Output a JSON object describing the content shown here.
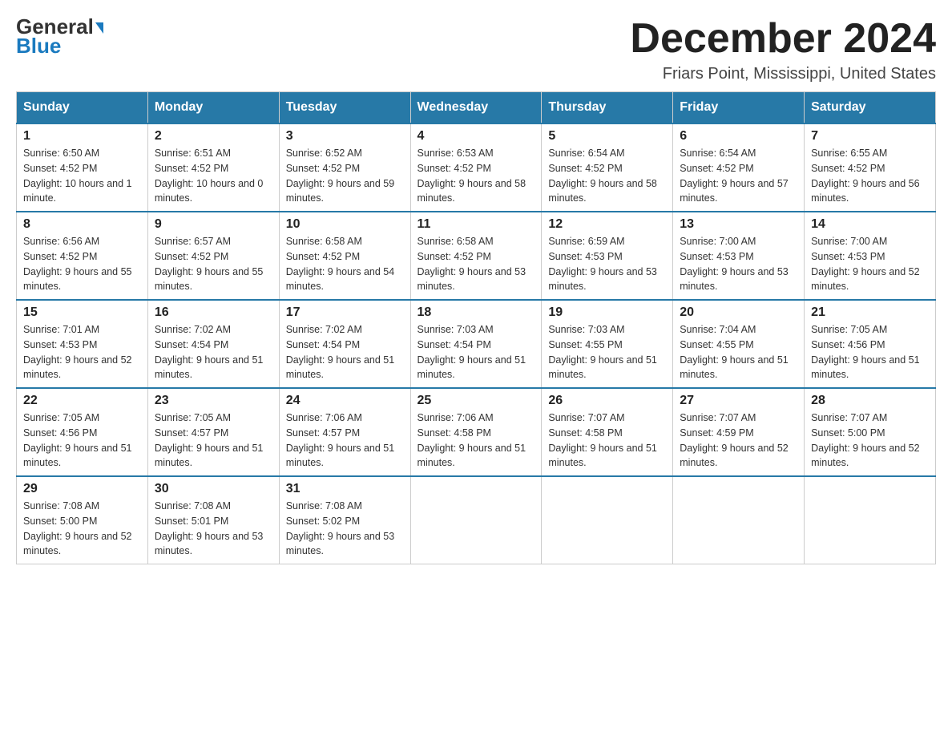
{
  "header": {
    "logo_line1": "General",
    "logo_line2": "Blue",
    "month_title": "December 2024",
    "location": "Friars Point, Mississippi, United States"
  },
  "days_of_week": [
    "Sunday",
    "Monday",
    "Tuesday",
    "Wednesday",
    "Thursday",
    "Friday",
    "Saturday"
  ],
  "weeks": [
    [
      {
        "day": "1",
        "sunrise": "6:50 AM",
        "sunset": "4:52 PM",
        "daylight": "10 hours and 1 minute."
      },
      {
        "day": "2",
        "sunrise": "6:51 AM",
        "sunset": "4:52 PM",
        "daylight": "10 hours and 0 minutes."
      },
      {
        "day": "3",
        "sunrise": "6:52 AM",
        "sunset": "4:52 PM",
        "daylight": "9 hours and 59 minutes."
      },
      {
        "day": "4",
        "sunrise": "6:53 AM",
        "sunset": "4:52 PM",
        "daylight": "9 hours and 58 minutes."
      },
      {
        "day": "5",
        "sunrise": "6:54 AM",
        "sunset": "4:52 PM",
        "daylight": "9 hours and 58 minutes."
      },
      {
        "day": "6",
        "sunrise": "6:54 AM",
        "sunset": "4:52 PM",
        "daylight": "9 hours and 57 minutes."
      },
      {
        "day": "7",
        "sunrise": "6:55 AM",
        "sunset": "4:52 PM",
        "daylight": "9 hours and 56 minutes."
      }
    ],
    [
      {
        "day": "8",
        "sunrise": "6:56 AM",
        "sunset": "4:52 PM",
        "daylight": "9 hours and 55 minutes."
      },
      {
        "day": "9",
        "sunrise": "6:57 AM",
        "sunset": "4:52 PM",
        "daylight": "9 hours and 55 minutes."
      },
      {
        "day": "10",
        "sunrise": "6:58 AM",
        "sunset": "4:52 PM",
        "daylight": "9 hours and 54 minutes."
      },
      {
        "day": "11",
        "sunrise": "6:58 AM",
        "sunset": "4:52 PM",
        "daylight": "9 hours and 53 minutes."
      },
      {
        "day": "12",
        "sunrise": "6:59 AM",
        "sunset": "4:53 PM",
        "daylight": "9 hours and 53 minutes."
      },
      {
        "day": "13",
        "sunrise": "7:00 AM",
        "sunset": "4:53 PM",
        "daylight": "9 hours and 53 minutes."
      },
      {
        "day": "14",
        "sunrise": "7:00 AM",
        "sunset": "4:53 PM",
        "daylight": "9 hours and 52 minutes."
      }
    ],
    [
      {
        "day": "15",
        "sunrise": "7:01 AM",
        "sunset": "4:53 PM",
        "daylight": "9 hours and 52 minutes."
      },
      {
        "day": "16",
        "sunrise": "7:02 AM",
        "sunset": "4:54 PM",
        "daylight": "9 hours and 51 minutes."
      },
      {
        "day": "17",
        "sunrise": "7:02 AM",
        "sunset": "4:54 PM",
        "daylight": "9 hours and 51 minutes."
      },
      {
        "day": "18",
        "sunrise": "7:03 AM",
        "sunset": "4:54 PM",
        "daylight": "9 hours and 51 minutes."
      },
      {
        "day": "19",
        "sunrise": "7:03 AM",
        "sunset": "4:55 PM",
        "daylight": "9 hours and 51 minutes."
      },
      {
        "day": "20",
        "sunrise": "7:04 AM",
        "sunset": "4:55 PM",
        "daylight": "9 hours and 51 minutes."
      },
      {
        "day": "21",
        "sunrise": "7:05 AM",
        "sunset": "4:56 PM",
        "daylight": "9 hours and 51 minutes."
      }
    ],
    [
      {
        "day": "22",
        "sunrise": "7:05 AM",
        "sunset": "4:56 PM",
        "daylight": "9 hours and 51 minutes."
      },
      {
        "day": "23",
        "sunrise": "7:05 AM",
        "sunset": "4:57 PM",
        "daylight": "9 hours and 51 minutes."
      },
      {
        "day": "24",
        "sunrise": "7:06 AM",
        "sunset": "4:57 PM",
        "daylight": "9 hours and 51 minutes."
      },
      {
        "day": "25",
        "sunrise": "7:06 AM",
        "sunset": "4:58 PM",
        "daylight": "9 hours and 51 minutes."
      },
      {
        "day": "26",
        "sunrise": "7:07 AM",
        "sunset": "4:58 PM",
        "daylight": "9 hours and 51 minutes."
      },
      {
        "day": "27",
        "sunrise": "7:07 AM",
        "sunset": "4:59 PM",
        "daylight": "9 hours and 52 minutes."
      },
      {
        "day": "28",
        "sunrise": "7:07 AM",
        "sunset": "5:00 PM",
        "daylight": "9 hours and 52 minutes."
      }
    ],
    [
      {
        "day": "29",
        "sunrise": "7:08 AM",
        "sunset": "5:00 PM",
        "daylight": "9 hours and 52 minutes."
      },
      {
        "day": "30",
        "sunrise": "7:08 AM",
        "sunset": "5:01 PM",
        "daylight": "9 hours and 53 minutes."
      },
      {
        "day": "31",
        "sunrise": "7:08 AM",
        "sunset": "5:02 PM",
        "daylight": "9 hours and 53 minutes."
      },
      null,
      null,
      null,
      null
    ]
  ]
}
